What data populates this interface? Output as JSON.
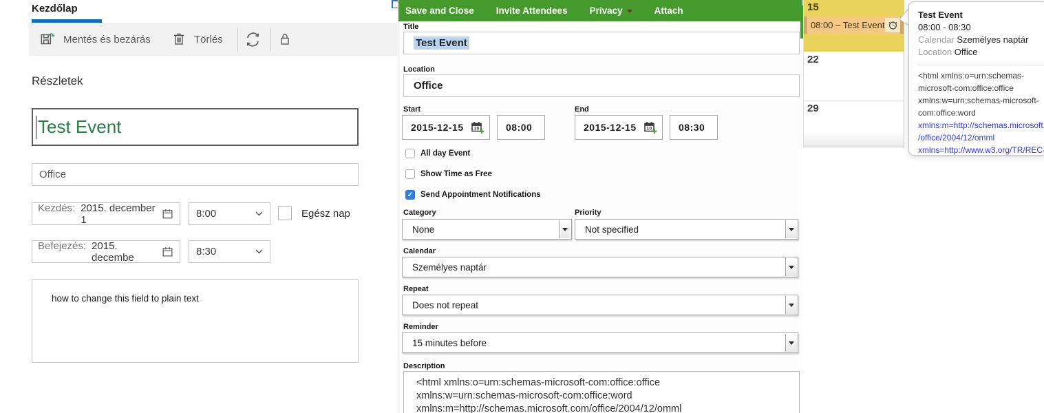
{
  "left_panel": {
    "tab_label": "Kezdőlap",
    "toolbar": {
      "save_label": "Mentés és bezárás",
      "delete_label": "Törlés"
    },
    "section_heading": "Részletek",
    "title_value": "Test Event",
    "location_value": "Office",
    "start": {
      "label": "Kezdés:",
      "date": "2015. december 1",
      "time": "8:00"
    },
    "end": {
      "label": "Befejezés:",
      "date": "2015. decembe",
      "time": "8:30"
    },
    "allday_label": "Egész nap",
    "notes_value": "how to change this field to plain text"
  },
  "editor": {
    "toolbar": {
      "save": "Save and Close",
      "invite": "Invite Attendees",
      "privacy": "Privacy",
      "attach": "Attach"
    },
    "title": {
      "label": "Title",
      "value": "Test Event"
    },
    "location": {
      "label": "Location",
      "value": "Office"
    },
    "start": {
      "label": "Start",
      "date": "2015-12-15",
      "time": "08:00"
    },
    "end": {
      "label": "End",
      "date": "2015-12-15",
      "time": "08:30"
    },
    "checkboxes": {
      "allday": "All day Event",
      "free": "Show Time as Free",
      "notifications": "Send Appointment Notifications",
      "check_glyph": "✓"
    },
    "category": {
      "label": "Category",
      "value": "None"
    },
    "priority": {
      "label": "Priority",
      "value": "Not specified"
    },
    "calendar": {
      "label": "Calendar",
      "value": "Személyes naptár"
    },
    "repeat": {
      "label": "Repeat",
      "value": "Does not repeat"
    },
    "reminder": {
      "label": "Reminder",
      "value": "15 minutes before"
    },
    "description": {
      "label": "Description",
      "lines": [
        "<html xmlns:o=urn:schemas-microsoft-com:office:office",
        "xmlns:w=urn:schemas-microsoft-com:office:word",
        "xmlns:m=http://schemas.microsoft.com/office/2004/12/omml"
      ]
    }
  },
  "mini_calendar": {
    "day_numbers": [
      "15",
      "22",
      "29"
    ],
    "event_label": "08:00 – Test Event"
  },
  "tooltip": {
    "title": "Test Event",
    "time_range": "08:00 - 08:30",
    "calendar_label": "Calendar",
    "calendar_value": "Személyes naptár",
    "location_label": "Location",
    "location_value": "Office",
    "body_lines": [
      "<html xmlns:o=urn:schemas-",
      "microsoft-com:office:office",
      "xmlns:w=urn:schemas-microsoft-",
      "com:office:word",
      "xmlns:m=http://schemas.microsoft.co",
      "/office/2004/12/omml",
      "xmlns=http://www.w3.org/TR/REC-"
    ]
  },
  "colors": {
    "accent_blue": "#0f6cbd",
    "toolbar_green": "#459a2d",
    "title_green": "#2d7d46",
    "selection_blue": "#b9d4f0",
    "checkbox_blue": "#2f7fe0",
    "day_yellow": "#e9d35b",
    "event_orange": "#f5c983",
    "link_blue": "#2f3bd3"
  }
}
